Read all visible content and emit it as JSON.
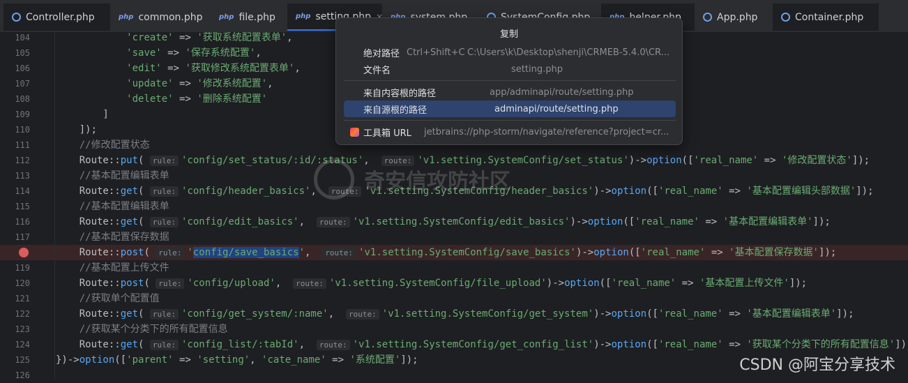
{
  "tabs": [
    {
      "name": "Controller.php",
      "icon": "class-icon"
    },
    {
      "name": "common.php",
      "icon": "php-icon"
    },
    {
      "name": "file.php",
      "icon": "php-icon"
    },
    {
      "name": "setting.php",
      "icon": "php-icon"
    },
    {
      "name": "system.php",
      "icon": "php-icon"
    },
    {
      "name": "SystemConfig.php",
      "icon": "class-icon"
    },
    {
      "name": "helper.php",
      "icon": "php-icon"
    },
    {
      "name": "App.php",
      "icon": "class-icon"
    },
    {
      "name": "Container.php",
      "icon": "class-icon"
    }
  ],
  "tab_close_glyph": "×",
  "code": {
    "lines": [
      {
        "n": "104",
        "text": "            'create' => '获取系统配置表单',"
      },
      {
        "n": "105",
        "text": "            'save' => '保存系统配置',"
      },
      {
        "n": "106",
        "text": "            'edit' => '获取修改系统配置表单',"
      },
      {
        "n": "107",
        "text": "            'update' => '修改系统配置',"
      },
      {
        "n": "108",
        "text": "            'delete' => '删除系统配置'"
      },
      {
        "n": "109",
        "text": "        ]"
      },
      {
        "n": "110",
        "text": "    ]);"
      },
      {
        "n": "111",
        "text": "    //修改配置状态"
      },
      {
        "n": "112",
        "text": "    Route::put( rule: 'config/set_status/:id/:status',  route: 'v1.setting.SystemConfig/set_status')->option(['real_name' => '修改配置状态']);"
      },
      {
        "n": "113",
        "text": "    //基本配置编辑表单"
      },
      {
        "n": "114",
        "text": "    Route::get( rule: 'config/header_basics',  route: 'v1.setting.SystemConfig/header_basics')->option(['real_name' => '基本配置编辑头部数据']);"
      },
      {
        "n": "115",
        "text": "    //基本配置编辑表单"
      },
      {
        "n": "116",
        "text": "    Route::get( rule: 'config/edit_basics',  route: 'v1.setting.SystemConfig/edit_basics')->option(['real_name' => '基本配置编辑表单']);"
      },
      {
        "n": "117",
        "text": "    //基本配置保存数据"
      },
      {
        "n": "",
        "text": "    Route::post( rule: 'config/save_basics',  route: 'v1.setting.SystemConfig/save_basics')->option(['real_name' => '基本配置保存数据']);"
      },
      {
        "n": "119",
        "text": "    //基本配置上传文件"
      },
      {
        "n": "120",
        "text": "    Route::post( rule: 'config/upload',  route: 'v1.setting.SystemConfig/file_upload')->option(['real_name' => '基本配置上传文件']);"
      },
      {
        "n": "121",
        "text": "    //获取单个配置值"
      },
      {
        "n": "122",
        "text": "    Route::get( rule: 'config/get_system/:name',  route: 'v1.setting.SystemConfig/get_system')->option(['real_name' => '基本配置编辑表单']);"
      },
      {
        "n": "123",
        "text": "    //获取某个分类下的所有配置信息"
      },
      {
        "n": "124",
        "text": "    Route::get( rule: 'config_list/:tabId',  route: 'v1.setting.SystemConfig/get_config_list')->option(['real_name' => '获取某个分类下的所有配置信息']);"
      },
      {
        "n": "125",
        "text": "})->option(['parent' => 'setting', 'cate_name' => '系统配置']);"
      },
      {
        "n": "126",
        "text": ""
      }
    ]
  },
  "popup": {
    "title": "复制",
    "items": [
      {
        "label": "绝对路径",
        "shortcut": "Ctrl+Shift+C",
        "value": "C:\\Users\\k\\Desktop\\shenji\\CRMEB-5.4.0\\CR..."
      },
      {
        "label": "文件名",
        "value": "setting.php"
      },
      {
        "label": "来自内容根的路径",
        "value": "app/adminapi/route/setting.php"
      },
      {
        "label": "来自源根的路径",
        "value": "adminapi/route/setting.php"
      },
      {
        "label": "工具箱 URL",
        "value": "jetbrains://php-storm/navigate/reference?project=cr..."
      }
    ]
  },
  "watermark": "奇安信攻防社区",
  "csdn": "CSDN @阿宝分享技术",
  "colors": {
    "bg": "#1e1f22",
    "string": "#6aab73",
    "comment": "#7a7e85",
    "keyword": "#cf8e6d",
    "breakpoint": "#db5c5c",
    "highlight": "#2e436e"
  }
}
